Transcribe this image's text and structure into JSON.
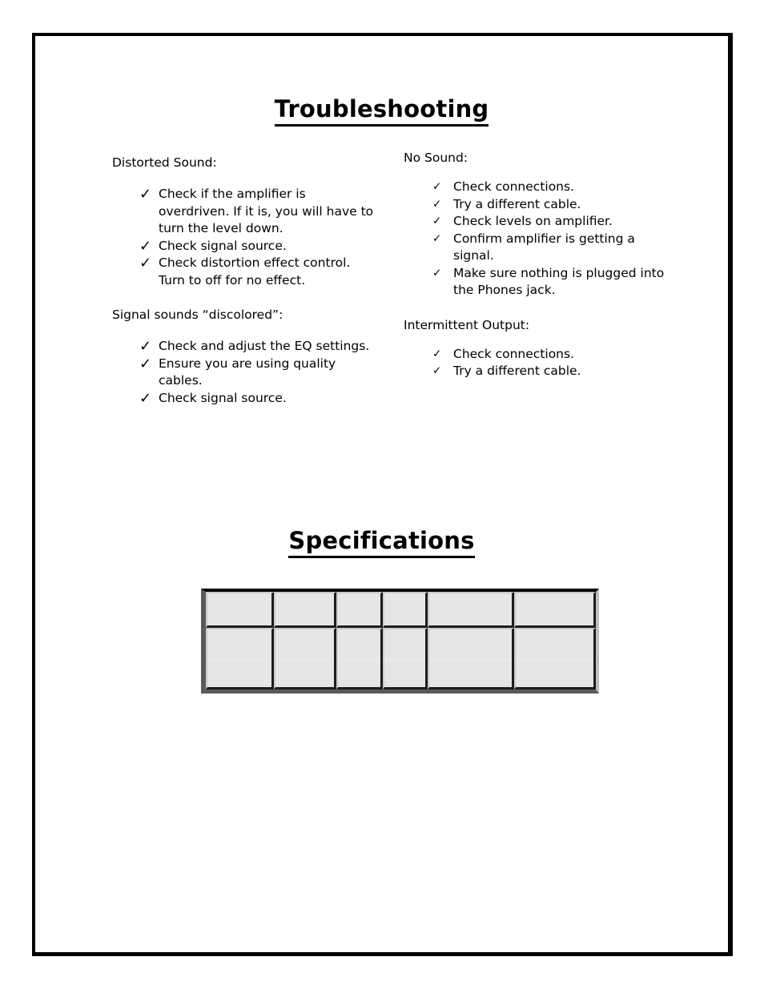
{
  "page": {
    "sections": [
      {
        "id": "troubleshooting",
        "title": "Troubleshooting"
      },
      {
        "id": "specifications",
        "title": "Specifications"
      }
    ]
  },
  "icons": {
    "check": "✓"
  },
  "troubleshooting": {
    "left_column": [
      {
        "heading": "Distorted Sound:",
        "items": [
          "Check if the amplifier is overdriven. If it is, you will have to turn the level down.",
          "Check signal source.",
          "Check distortion effect control. Turn to off for no effect."
        ]
      },
      {
        "heading": "Signal sounds “discolored”:",
        "items": [
          "Check and adjust the EQ settings.",
          "Ensure you are using quality cables.",
          "Check signal source."
        ]
      }
    ],
    "right_column": [
      {
        "heading": "No Sound:",
        "items": [
          "Check connections.",
          "Try a different cable.",
          "Check levels on amplifier.",
          "Confirm amplifier is getting a signal.",
          "Make sure nothing is plugged into the Phones jack."
        ]
      },
      {
        "heading": "Intermittent Output:",
        "items": [
          "Check connections.",
          "Try a different cable."
        ]
      }
    ]
  },
  "specifications": {
    "table": {
      "column_count": 6,
      "row_count": 2,
      "rows": [
        [
          "",
          "",
          "",
          "",
          "",
          ""
        ],
        [
          "",
          "",
          "",
          "",
          "",
          ""
        ]
      ]
    }
  }
}
